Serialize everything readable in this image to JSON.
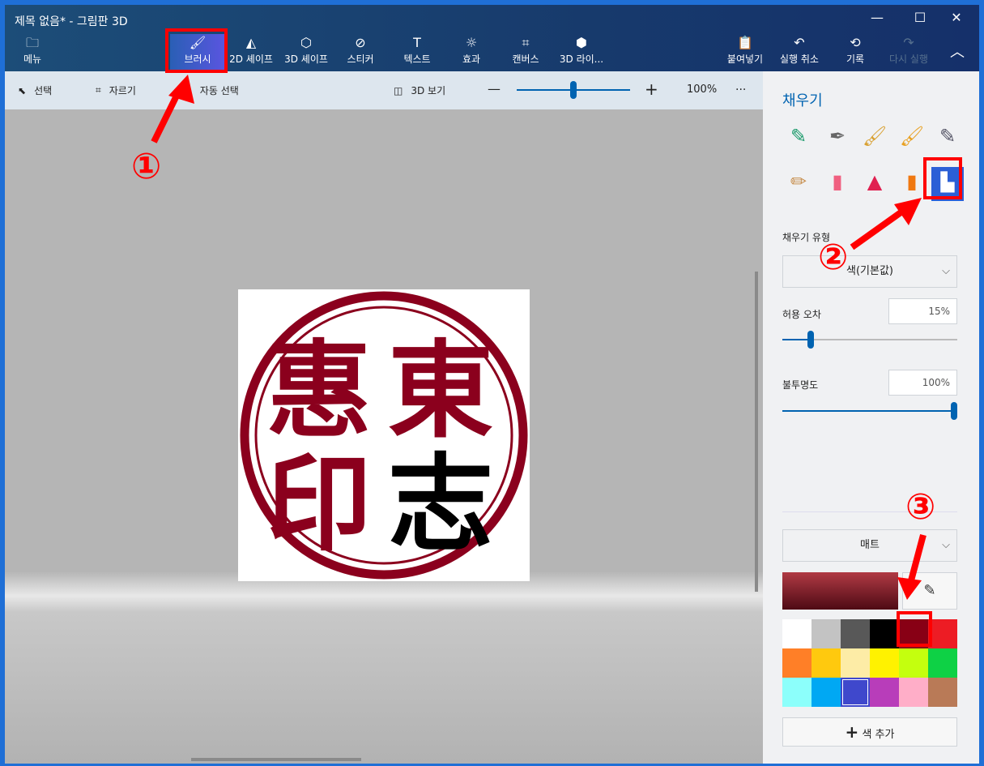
{
  "window": {
    "title": "제목 없음* - 그림판 3D",
    "minimize": "—",
    "maximize": "☐",
    "close": "✕"
  },
  "toolbar": {
    "menu": {
      "label": "메뉴",
      "icon": "folder-icon"
    },
    "tools": [
      {
        "label": "브러시",
        "icon": "brush-icon",
        "active": true
      },
      {
        "label": "2D 셰이프",
        "icon": "2d-shapes-icon"
      },
      {
        "label": "3D 셰이프",
        "icon": "3d-shapes-icon"
      },
      {
        "label": "스티커",
        "icon": "sticker-icon"
      },
      {
        "label": "텍스트",
        "icon": "text-icon"
      },
      {
        "label": "효과",
        "icon": "effects-icon"
      },
      {
        "label": "캔버스",
        "icon": "canvas-icon"
      },
      {
        "label": "3D 라이...",
        "icon": "3d-library-icon"
      }
    ],
    "paste": "붙여넣기",
    "undo": "실행 취소",
    "history": "기록",
    "redo": "다시 실행"
  },
  "subtoolbar": {
    "select": "선택",
    "crop": "자르기",
    "magic_select": "자동 선택",
    "view3d": "3D 보기",
    "zoom_minus": "—",
    "zoom_plus": "+",
    "zoom": "100%",
    "more": "···",
    "zoom_fraction": 0.5
  },
  "canvas": {
    "stamp_text": [
      "惠",
      "東",
      "印",
      "志"
    ]
  },
  "panel": {
    "title": "채우기",
    "fill_type_label": "채우기 유형",
    "fill_type_value": "색(기본값)",
    "tolerance_label": "허용 오차",
    "tolerance_value": "15%",
    "tolerance": 15,
    "opacity_label": "불투명도",
    "opacity_value": "100%",
    "opacity": 100,
    "finish": "매트",
    "current_color": "#8a1a24",
    "eyedropper": "eyedropper-icon",
    "add_color": "색 추가",
    "add_icon": "+",
    "palette": [
      "#ffffff",
      "#c3c3c3",
      "#585858",
      "#000000",
      "#880015",
      "#ed1c24",
      "#ff7f27",
      "#ffc90e",
      "#fdeca6",
      "#fff200",
      "#c4ff0e",
      "#0ed145",
      "#8cfffb",
      "#00a8f3",
      "#3f48cc",
      "#b83dba",
      "#ffaec8",
      "#b97a57"
    ]
  },
  "annotations": [
    "①",
    "②",
    "③"
  ]
}
